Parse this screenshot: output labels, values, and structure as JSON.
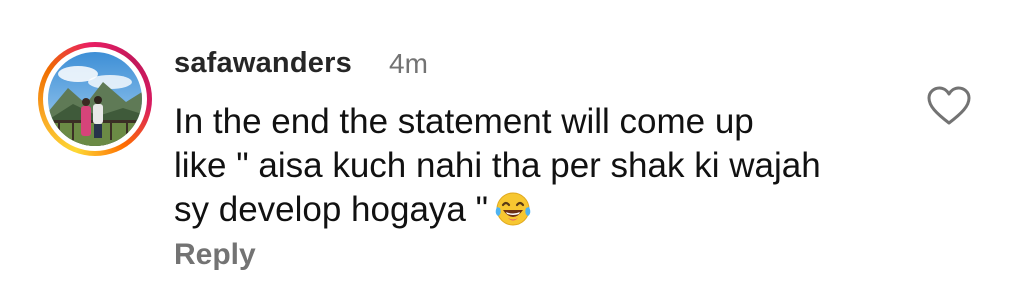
{
  "comment": {
    "username": "safawanders",
    "timestamp": "4m",
    "lines": [
      "In the end the statement will come up",
      "like \" aisa kuch nahi tha per shak ki wajah",
      "sy develop hogaya \""
    ],
    "emoji": "face-with-tears-of-joy-icon",
    "reply_label": "Reply"
  },
  "icons": {
    "like": "heart-outline-icon",
    "avatar_ring": "story-ring"
  },
  "colors": {
    "text": "#111111",
    "username": "#262626",
    "muted": "#737373",
    "ring_start": "#fdd835",
    "ring_end": "#d81b60"
  }
}
